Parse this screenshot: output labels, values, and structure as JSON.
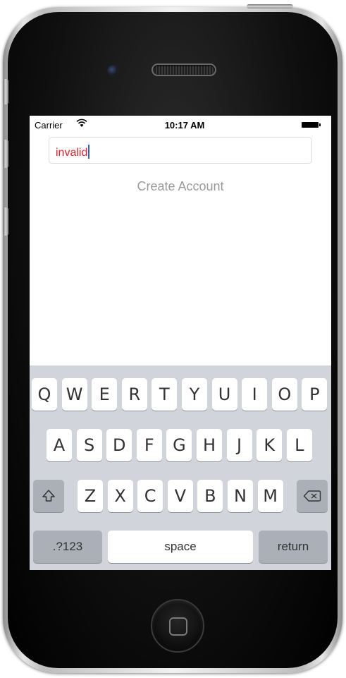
{
  "status_bar": {
    "carrier": "Carrier",
    "time": "10:17 AM"
  },
  "form": {
    "text_field_value": "invalid",
    "text_field_color": "#e0202a",
    "create_account_label": "Create Account"
  },
  "keyboard": {
    "row1": [
      "Q",
      "W",
      "E",
      "R",
      "T",
      "Y",
      "U",
      "I",
      "O",
      "P"
    ],
    "row2": [
      "A",
      "S",
      "D",
      "F",
      "G",
      "H",
      "J",
      "K",
      "L"
    ],
    "row3": [
      "Z",
      "X",
      "C",
      "V",
      "B",
      "N",
      "M"
    ],
    "shift_icon": "shift-icon",
    "delete_icon": "delete-icon",
    "numbers_label": ".?123",
    "space_label": "space",
    "return_label": "return"
  }
}
